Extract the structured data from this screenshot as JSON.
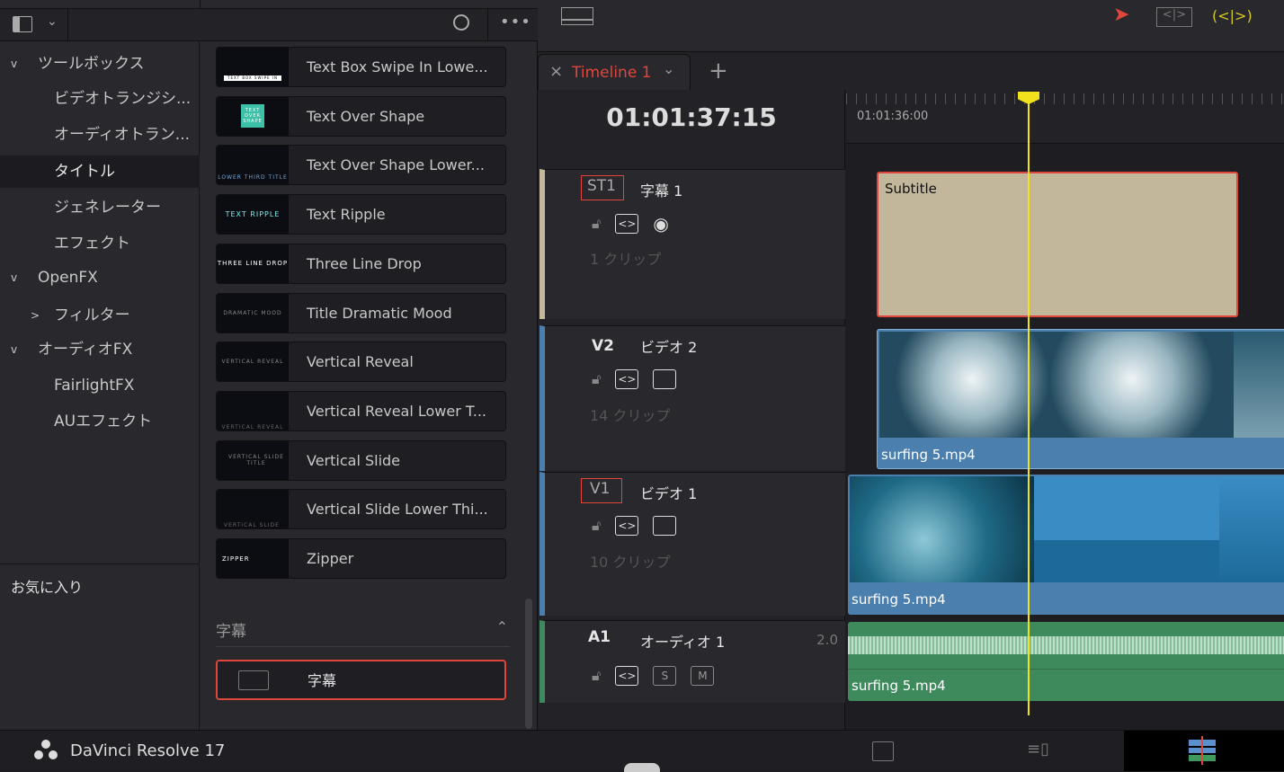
{
  "left_header": {
    "panel_toggle_icon": "panel-layout-icon",
    "search_icon": "search-icon",
    "more_icon": "ellipsis-icon"
  },
  "sidebar": {
    "items": [
      {
        "label": "ツールボックス",
        "expander": "v"
      },
      {
        "label": "ビデオトランジシ..."
      },
      {
        "label": "オーディオトラン..."
      },
      {
        "label": "タイトル",
        "selected": true
      },
      {
        "label": "ジェネレーター"
      },
      {
        "label": "エフェクト"
      },
      {
        "label": "OpenFX",
        "expander": "v"
      },
      {
        "label": "フィルター",
        "expander": ">"
      },
      {
        "label": "オーディオFX",
        "expander": "v"
      },
      {
        "label": "FairlightFX"
      },
      {
        "label": "AUエフェクト"
      }
    ],
    "favorites": "お気に入り"
  },
  "titles": {
    "items": [
      {
        "label": "Text Box Swipe In Lowe...",
        "thumb": "TEXT BOX SWIPE IN"
      },
      {
        "label": "Text Over Shape",
        "thumb": "TEXT OVER SHAPE"
      },
      {
        "label": "Text Over Shape Lower...",
        "thumb": "LOWER THIRD TITLE"
      },
      {
        "label": "Text Ripple",
        "thumb": "TEXT RIPPLE"
      },
      {
        "label": "Three Line Drop",
        "thumb": "THREE LINE DROP"
      },
      {
        "label": "Title Dramatic Mood",
        "thumb": "DRAMATIC MOOD"
      },
      {
        "label": "Vertical Reveal",
        "thumb": "VERTICAL REVEAL"
      },
      {
        "label": "Vertical Reveal Lower T...",
        "thumb": "VERTICAL REVEAL"
      },
      {
        "label": "Vertical Slide",
        "thumb": "VERTICAL SLIDE TITLE"
      },
      {
        "label": "Vertical Slide Lower Thi...",
        "thumb": "VERTICAL SLIDE"
      },
      {
        "label": "Zipper",
        "thumb": "ZIPPER"
      }
    ],
    "subtitle_section": "字幕",
    "subtitle_item": "字幕"
  },
  "timeline": {
    "tab": "Timeline 1",
    "add": "+",
    "close": "×",
    "timecode": "01:01:37:15",
    "ruler_label": "01:01:36:00",
    "tracks": [
      {
        "id": "ST1",
        "name": "字幕 1",
        "count": "1 クリップ",
        "clip": "Subtitle"
      },
      {
        "id": "V2",
        "name": "ビデオ 2",
        "count": "14 クリップ",
        "clip": "surfing 5.mp4"
      },
      {
        "id": "V1",
        "name": "ビデオ 1",
        "count": "10 クリップ",
        "clip": "surfing 5.mp4"
      },
      {
        "id": "A1",
        "name": "オーディオ 1",
        "level": "2.0",
        "clip": "surfing 5.mp4",
        "solo": "S",
        "mute": "M"
      }
    ]
  },
  "colors": {
    "accent_red": "#e0463c",
    "playhead": "#f2e21b",
    "video_clip": "#4a7fae",
    "audio_clip": "#3e8a5c",
    "subtitle_clip": "#c2b79a"
  },
  "footer": {
    "app": "DaVinci Resolve 17"
  }
}
